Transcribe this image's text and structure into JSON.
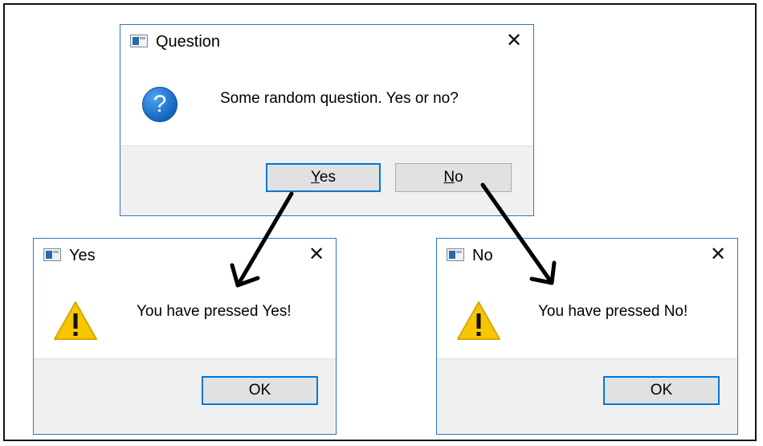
{
  "question_dialog": {
    "title": "Question",
    "message": "Some random question. Yes or no?",
    "close_glyph": "✕",
    "yes_mnemonic": "Y",
    "yes_rest": "es",
    "no_mnemonic": "N",
    "no_rest": "o",
    "icon": "question-icon"
  },
  "yes_dialog": {
    "title": "Yes",
    "message": "You have pressed Yes!",
    "close_glyph": "✕",
    "ok_label": "OK",
    "icon": "warning-icon"
  },
  "no_dialog": {
    "title": "No",
    "message": "You have pressed No!",
    "close_glyph": "✕",
    "ok_label": "OK",
    "icon": "warning-icon"
  },
  "colors": {
    "accent": "#0078d7",
    "dialog_border": "#2b78c9",
    "footer_bg": "#f0f0f0",
    "button_bg": "#e1e1e1",
    "warning_fill": "#f7c600"
  }
}
